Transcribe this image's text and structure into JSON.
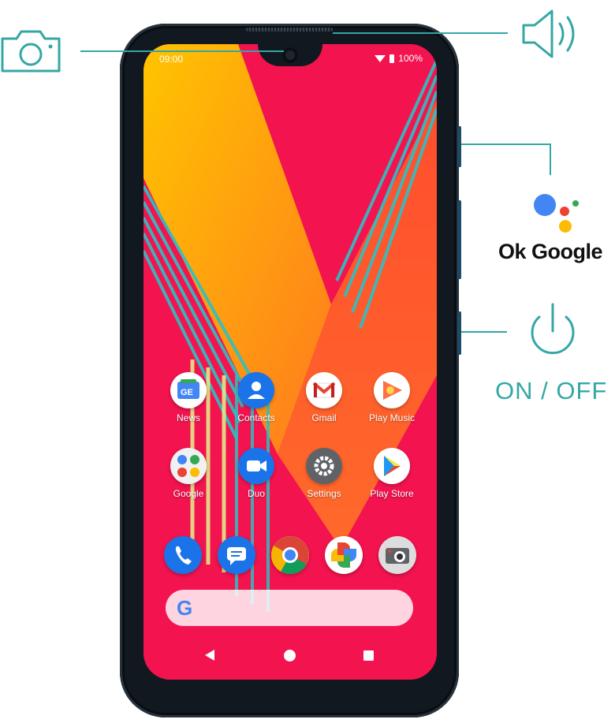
{
  "status_bar": {
    "time": "09:00",
    "battery": "100%"
  },
  "apps_row1": [
    {
      "label": "News",
      "icon": "google-news-icon"
    },
    {
      "label": "Contacts",
      "icon": "contacts-icon"
    },
    {
      "label": "Gmail",
      "icon": "gmail-icon"
    },
    {
      "label": "Play Music",
      "icon": "play-music-icon"
    }
  ],
  "apps_row2": [
    {
      "label": "Google",
      "icon": "google-folder-icon"
    },
    {
      "label": "Duo",
      "icon": "duo-icon"
    },
    {
      "label": "Settings",
      "icon": "gear-icon"
    },
    {
      "label": "Play Store",
      "icon": "play-store-icon"
    }
  ],
  "dock": [
    "phone-icon",
    "messages-icon",
    "chrome-icon",
    "photos-icon",
    "camera-app-icon"
  ],
  "search": {
    "logo": "G"
  },
  "callouts": {
    "assistant_label": "Ok Google",
    "power_label": "ON / OFF"
  },
  "colors": {
    "accent": "#34a7a5",
    "wallpaper": "#f2134f"
  }
}
